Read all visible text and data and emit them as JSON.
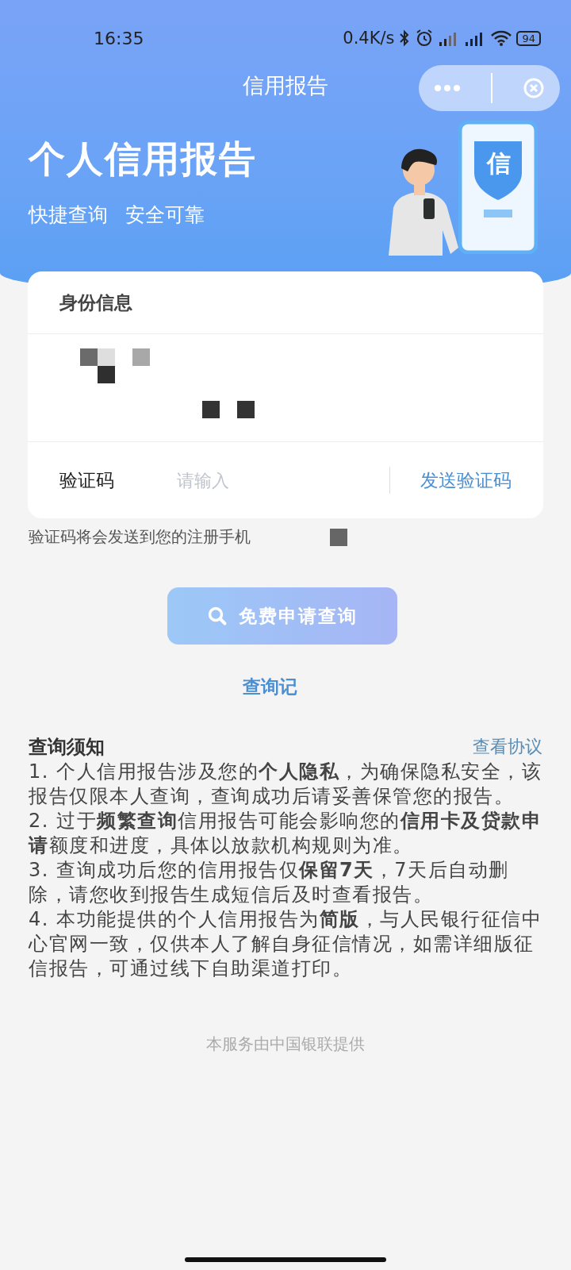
{
  "status_bar": {
    "time": "16:35",
    "speed": "0.4K/s",
    "battery": "94"
  },
  "nav": {
    "title": "信用报告"
  },
  "hero": {
    "title": "个人信用报告",
    "tags": [
      "快捷查询",
      "安全可靠"
    ],
    "badge": "信"
  },
  "form": {
    "section_title": "身份信息",
    "code_label": "验证码",
    "code_placeholder": "请输入",
    "send_button": "发送验证码",
    "hint": "验证码将会发送到您的注册手机"
  },
  "apply_button": "免费申请查询",
  "records_link": "查询记",
  "notice": {
    "title": "查询须知",
    "agreement_link": "查看协议",
    "items": [
      "1. 个人信用报告涉及您的**个人隐私**，为确保隐私安全，该报告仅限本人查询，查询成功后请妥善保管您的报告。",
      "2. 过于**频繁查询**信用报告可能会影响您的**信用卡及贷款申请**额度和进度，具体以放款机构规则为准。",
      "3. 查询成功后您的信用报告仅**保留7天**，7天后自动删除，请您收到报告生成短信后及时查看报告。",
      "4. 本功能提供的个人信用报告为**简版**，与人民银行征信中心官网一致，仅供本人了解自身征信情况，如需详细版征信报告，可通过线下自助渠道打印。"
    ]
  },
  "footer": "本服务由中国银联提供"
}
